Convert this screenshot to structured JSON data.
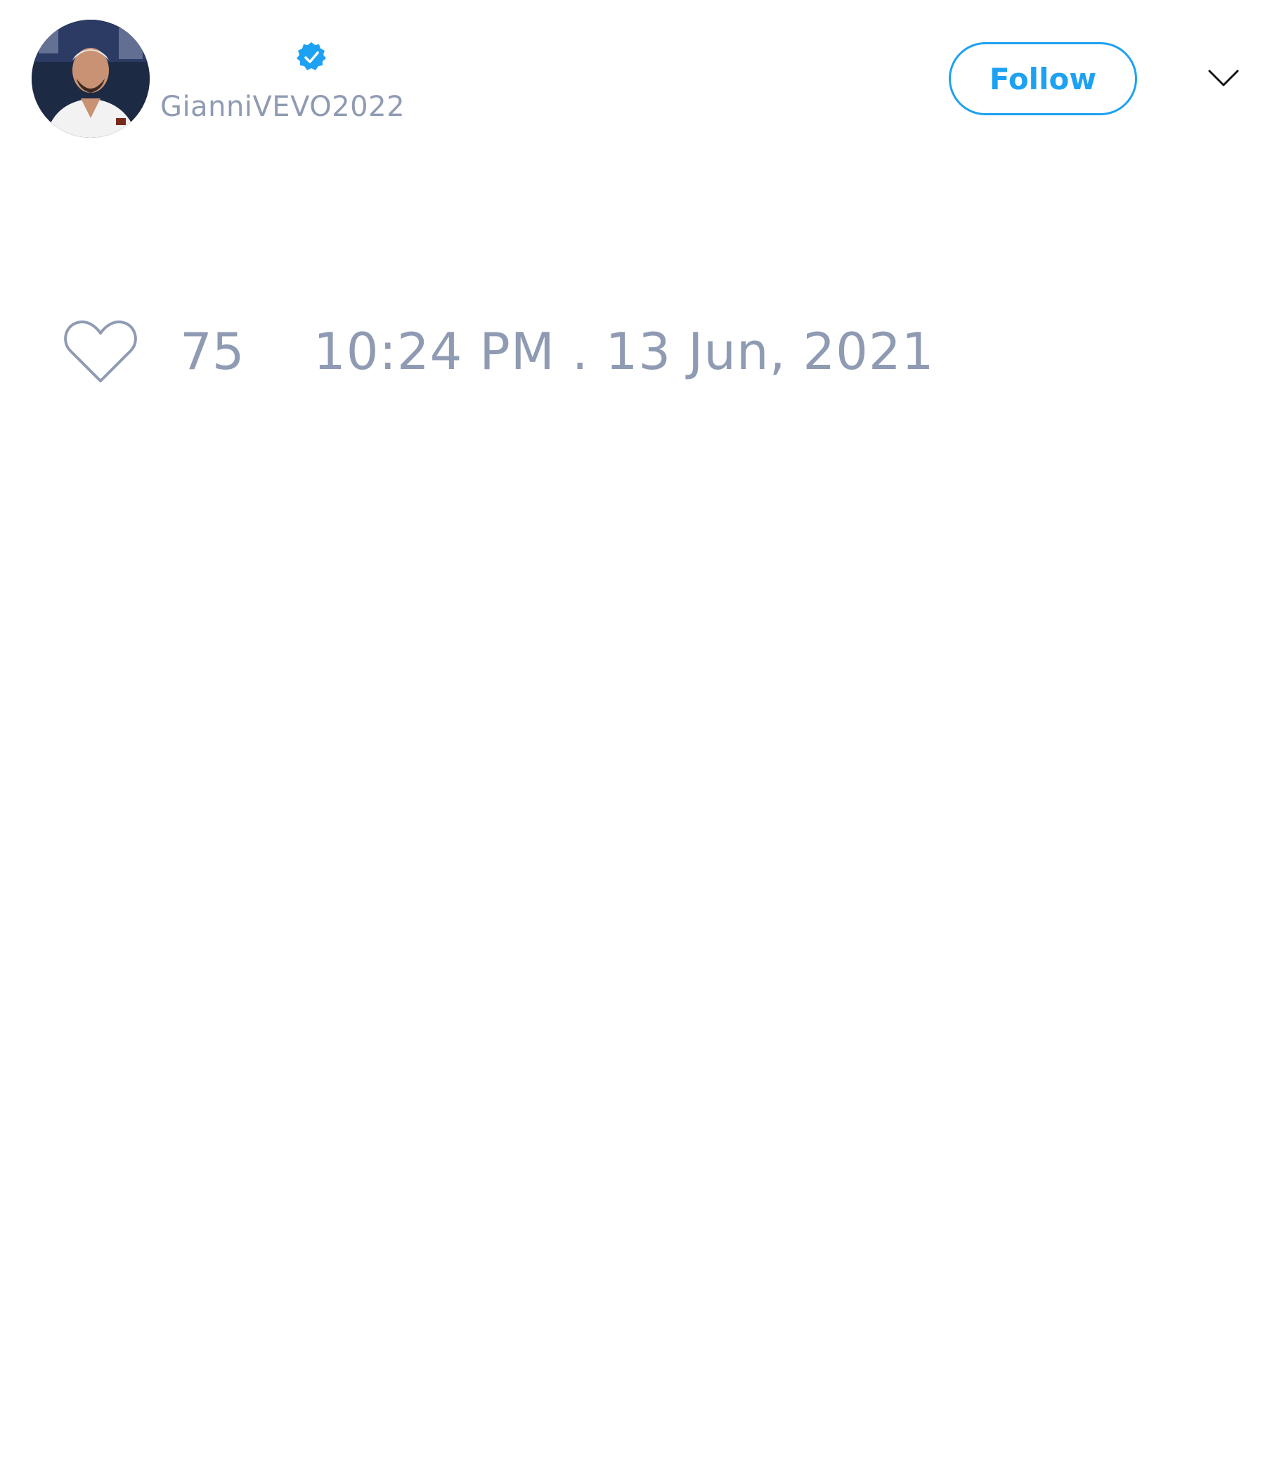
{
  "tweet": {
    "author": {
      "display_name": "",
      "handle": "GianniVEVO2022",
      "verified": true,
      "avatar_icon": "avatar-photo"
    },
    "follow_button": {
      "label": "Follow"
    },
    "menu_icon": "chevron-down-icon",
    "actions": {
      "like_icon": "heart-icon",
      "like_count": "75",
      "timestamp": "10:24 PM . 13 Jun, 2021"
    }
  },
  "colors": {
    "accent": "#1da1f2",
    "muted_text": "#8f9bb3",
    "background": "#ffffff",
    "verified_badge": "#1da1f2"
  }
}
